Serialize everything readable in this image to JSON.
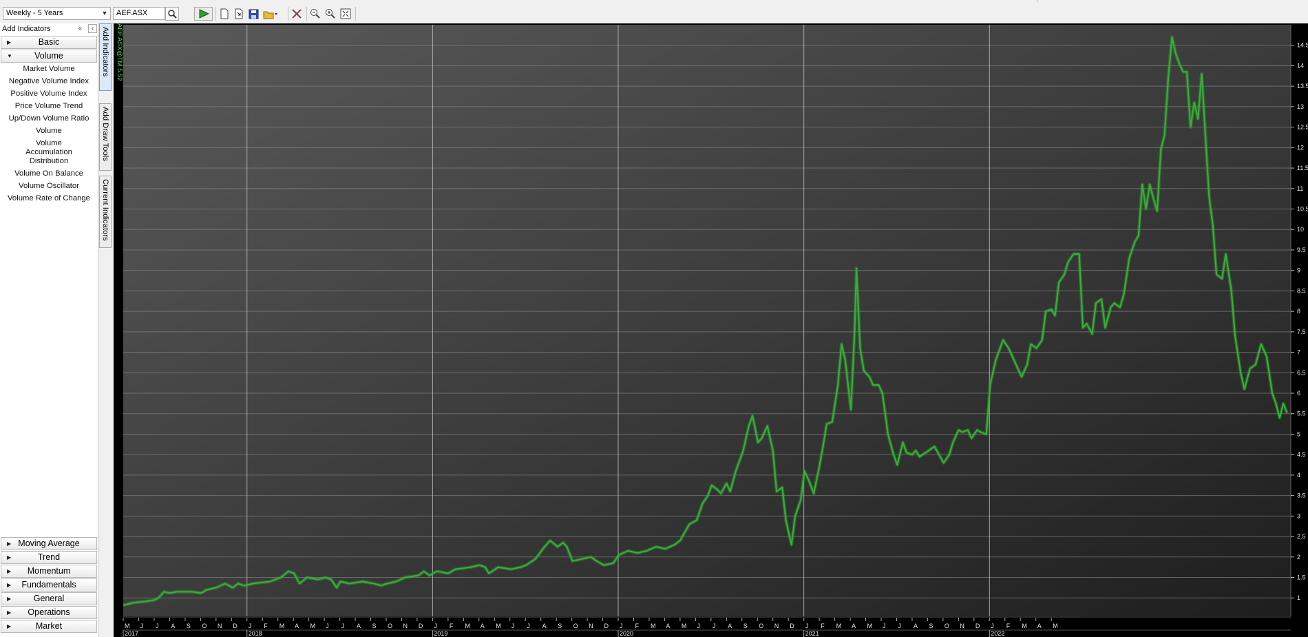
{
  "toolbar": {
    "period": "Weekly - 5 Years",
    "symbol": "AEF.ASX"
  },
  "left_panel": {
    "header": "Add Indicators",
    "categories_top": [
      "Basic",
      "Volume"
    ],
    "volume_items": [
      "Market Volume",
      "Negative Volume Index",
      "Positive Volume Index",
      "Price Volume Trend",
      "Up/Down Volume Ratio",
      "Volume",
      "Volume Accumulation Distribution",
      "Volume On Balance",
      "Volume Oscillator",
      "Volume Rate of Change"
    ],
    "categories_bottom": [
      "Moving Average",
      "Trend",
      "Momentum",
      "Fundamentals",
      "General",
      "Operations",
      "Market"
    ]
  },
  "side_tabs": [
    "Add Indicators",
    "Add Draw Tools",
    "Current Indicators"
  ],
  "chart_label": "AEF.ASX@TM 5.52",
  "colors": {
    "line": "#35b035",
    "background_top": "#5a5a5a",
    "background_bottom": "#1e1e1e",
    "grid": "#8c8c8c"
  },
  "chart_data": {
    "type": "line",
    "series_name": "",
    "x_start": "2017-05",
    "x_end": "2022-05",
    "ylim": [
      0.55,
      15.0
    ],
    "yticks": [
      "1",
      "1.5",
      "2",
      "2.5",
      "3",
      "3.5",
      "4",
      "4.5",
      "5",
      "5.5",
      "6",
      "6.5",
      "7",
      "7.5",
      "8",
      "8.5",
      "9",
      "9.5",
      "10",
      "10.5",
      "11",
      "11.5",
      "12",
      "12.5",
      "13",
      "13.5",
      "14",
      "14.5"
    ],
    "month_labels": [
      "M",
      "J",
      "J",
      "A",
      "S",
      "O",
      "N",
      "D",
      "J",
      "F",
      "M",
      "A",
      "M",
      "J",
      "J",
      "A",
      "S",
      "O",
      "N",
      "D",
      "J",
      "F",
      "M",
      "A",
      "M",
      "J",
      "J",
      "A",
      "S",
      "O",
      "N",
      "D",
      "J",
      "F",
      "M",
      "A",
      "M",
      "J",
      "J",
      "A",
      "S",
      "O",
      "N",
      "D",
      "J",
      "F",
      "M",
      "A",
      "M",
      "J",
      "J",
      "A",
      "S",
      "O",
      "N",
      "D",
      "J",
      "F",
      "M",
      "A",
      "M"
    ],
    "year_labels": [
      {
        "year": "2017",
        "month_index": 0
      },
      {
        "year": "2018",
        "month_index": 8
      },
      {
        "year": "2019",
        "month_index": 20
      },
      {
        "year": "2020",
        "month_index": 32
      },
      {
        "year": "2021",
        "month_index": 44
      },
      {
        "year": "2022",
        "month_index": 56
      }
    ],
    "points": [
      [
        2017.33,
        0.82
      ],
      [
        2017.38,
        0.88
      ],
      [
        2017.42,
        0.9
      ],
      [
        2017.46,
        0.92
      ],
      [
        2017.5,
        0.95
      ],
      [
        2017.52,
        1.0
      ],
      [
        2017.55,
        1.15
      ],
      [
        2017.58,
        1.12
      ],
      [
        2017.62,
        1.15
      ],
      [
        2017.7,
        1.15
      ],
      [
        2017.75,
        1.12
      ],
      [
        2017.78,
        1.2
      ],
      [
        2017.83,
        1.25
      ],
      [
        2017.88,
        1.35
      ],
      [
        2017.92,
        1.25
      ],
      [
        2017.95,
        1.35
      ],
      [
        2017.98,
        1.3
      ],
      [
        2018.03,
        1.35
      ],
      [
        2018.08,
        1.38
      ],
      [
        2018.12,
        1.4
      ],
      [
        2018.15,
        1.45
      ],
      [
        2018.18,
        1.5
      ],
      [
        2018.22,
        1.65
      ],
      [
        2018.25,
        1.6
      ],
      [
        2018.28,
        1.35
      ],
      [
        2018.32,
        1.5
      ],
      [
        2018.38,
        1.45
      ],
      [
        2018.42,
        1.5
      ],
      [
        2018.45,
        1.45
      ],
      [
        2018.48,
        1.25
      ],
      [
        2018.5,
        1.4
      ],
      [
        2018.55,
        1.35
      ],
      [
        2018.62,
        1.4
      ],
      [
        2018.68,
        1.35
      ],
      [
        2018.72,
        1.3
      ],
      [
        2018.75,
        1.35
      ],
      [
        2018.8,
        1.4
      ],
      [
        2018.85,
        1.5
      ],
      [
        2018.92,
        1.55
      ],
      [
        2018.95,
        1.65
      ],
      [
        2018.98,
        1.55
      ],
      [
        2019.02,
        1.65
      ],
      [
        2019.08,
        1.6
      ],
      [
        2019.12,
        1.7
      ],
      [
        2019.2,
        1.75
      ],
      [
        2019.25,
        1.8
      ],
      [
        2019.28,
        1.75
      ],
      [
        2019.3,
        1.6
      ],
      [
        2019.35,
        1.75
      ],
      [
        2019.42,
        1.7
      ],
      [
        2019.47,
        1.75
      ],
      [
        2019.5,
        1.8
      ],
      [
        2019.55,
        1.95
      ],
      [
        2019.6,
        2.25
      ],
      [
        2019.63,
        2.4
      ],
      [
        2019.67,
        2.25
      ],
      [
        2019.7,
        2.35
      ],
      [
        2019.72,
        2.25
      ],
      [
        2019.75,
        1.9
      ],
      [
        2019.8,
        1.95
      ],
      [
        2019.85,
        2.0
      ],
      [
        2019.88,
        1.9
      ],
      [
        2019.92,
        1.8
      ],
      [
        2019.97,
        1.85
      ],
      [
        2020.0,
        2.05
      ],
      [
        2020.05,
        2.15
      ],
      [
        2020.1,
        2.1
      ],
      [
        2020.15,
        2.15
      ],
      [
        2020.2,
        2.25
      ],
      [
        2020.25,
        2.2
      ],
      [
        2020.3,
        2.3
      ],
      [
        2020.33,
        2.4
      ],
      [
        2020.38,
        2.8
      ],
      [
        2020.42,
        2.9
      ],
      [
        2020.45,
        3.3
      ],
      [
        2020.48,
        3.5
      ],
      [
        2020.5,
        3.75
      ],
      [
        2020.53,
        3.65
      ],
      [
        2020.55,
        3.55
      ],
      [
        2020.58,
        3.8
      ],
      [
        2020.6,
        3.6
      ],
      [
        2020.63,
        4.1
      ],
      [
        2020.67,
        4.6
      ],
      [
        2020.7,
        5.2
      ],
      [
        2020.72,
        5.45
      ],
      [
        2020.75,
        4.8
      ],
      [
        2020.77,
        4.9
      ],
      [
        2020.8,
        5.2
      ],
      [
        2020.83,
        4.6
      ],
      [
        2020.85,
        3.6
      ],
      [
        2020.88,
        3.7
      ],
      [
        2020.9,
        2.9
      ],
      [
        2020.93,
        2.3
      ],
      [
        2020.95,
        3.0
      ],
      [
        2020.98,
        3.4
      ],
      [
        2021.0,
        4.1
      ],
      [
        2021.03,
        3.8
      ],
      [
        2021.05,
        3.55
      ],
      [
        2021.08,
        4.2
      ],
      [
        2021.1,
        4.7
      ],
      [
        2021.12,
        5.25
      ],
      [
        2021.15,
        5.3
      ],
      [
        2021.18,
        6.2
      ],
      [
        2021.2,
        7.2
      ],
      [
        2021.22,
        6.8
      ],
      [
        2021.25,
        5.6
      ],
      [
        2021.27,
        7.5
      ],
      [
        2021.28,
        9.05
      ],
      [
        2021.3,
        7.1
      ],
      [
        2021.32,
        6.55
      ],
      [
        2021.35,
        6.4
      ],
      [
        2021.37,
        6.2
      ],
      [
        2021.4,
        6.2
      ],
      [
        2021.42,
        6.0
      ],
      [
        2021.45,
        5.0
      ],
      [
        2021.48,
        4.5
      ],
      [
        2021.5,
        4.25
      ],
      [
        2021.53,
        4.8
      ],
      [
        2021.55,
        4.55
      ],
      [
        2021.58,
        4.5
      ],
      [
        2021.6,
        4.6
      ],
      [
        2021.62,
        4.45
      ],
      [
        2021.67,
        4.6
      ],
      [
        2021.7,
        4.7
      ],
      [
        2021.75,
        4.3
      ],
      [
        2021.78,
        4.5
      ],
      [
        2021.8,
        4.8
      ],
      [
        2021.83,
        5.1
      ],
      [
        2021.85,
        5.05
      ],
      [
        2021.88,
        5.1
      ],
      [
        2021.9,
        4.9
      ],
      [
        2021.93,
        5.1
      ],
      [
        2021.95,
        5.05
      ],
      [
        2021.98,
        5.0
      ],
      [
        2022.0,
        6.2
      ],
      [
        2022.03,
        6.8
      ],
      [
        2022.07,
        7.3
      ],
      [
        2022.1,
        7.1
      ],
      [
        2022.13,
        6.8
      ],
      [
        2022.17,
        6.4
      ],
      [
        2022.2,
        6.7
      ],
      [
        2022.22,
        7.2
      ],
      [
        2022.25,
        7.1
      ],
      [
        2022.28,
        7.3
      ],
      [
        2022.3,
        8.0
      ],
      [
        2022.33,
        8.05
      ],
      [
        2022.35,
        7.9
      ],
      [
        2022.37,
        8.7
      ],
      [
        2022.4,
        8.9
      ],
      [
        2022.42,
        9.2
      ],
      [
        2022.45,
        9.4
      ],
      [
        2022.48,
        9.4
      ],
      [
        2022.5,
        7.6
      ],
      [
        2022.52,
        7.7
      ],
      [
        2022.55,
        7.45
      ],
      [
        2022.57,
        8.2
      ],
      [
        2022.6,
        8.3
      ],
      [
        2022.62,
        7.6
      ],
      [
        2022.65,
        8.1
      ],
      [
        2022.67,
        8.2
      ],
      [
        2022.7,
        8.1
      ],
      [
        2022.72,
        8.4
      ],
      [
        2022.75,
        9.3
      ],
      [
        2022.78,
        9.7
      ],
      [
        2022.8,
        9.85
      ],
      [
        2022.82,
        11.1
      ],
      [
        2022.84,
        10.5
      ],
      [
        2022.86,
        11.1
      ],
      [
        2022.88,
        10.75
      ],
      [
        2022.9,
        10.45
      ],
      [
        2022.92,
        11.95
      ],
      [
        2022.94,
        12.3
      ],
      [
        2022.96,
        13.7
      ],
      [
        2022.98,
        14.7
      ],
      [
        2023.0,
        14.3
      ],
      [
        2023.02,
        14.05
      ],
      [
        2023.04,
        13.85
      ],
      [
        2023.06,
        13.85
      ],
      [
        2023.08,
        12.5
      ],
      [
        2023.1,
        13.1
      ],
      [
        2023.12,
        12.7
      ],
      [
        2023.14,
        13.8
      ],
      [
        2023.16,
        12.3
      ],
      [
        2023.18,
        10.8
      ],
      [
        2023.2,
        10.1
      ],
      [
        2023.22,
        8.9
      ],
      [
        2023.25,
        8.8
      ],
      [
        2023.27,
        9.4
      ],
      [
        2023.3,
        8.5
      ],
      [
        2023.32,
        7.4
      ],
      [
        2023.35,
        6.5
      ],
      [
        2023.37,
        6.1
      ],
      [
        2023.4,
        6.6
      ],
      [
        2023.43,
        6.7
      ],
      [
        2023.46,
        7.2
      ],
      [
        2023.49,
        6.9
      ],
      [
        2023.52,
        6.0
      ],
      [
        2023.54,
        5.75
      ],
      [
        2023.56,
        5.4
      ],
      [
        2023.58,
        5.75
      ],
      [
        2023.6,
        5.52
      ]
    ]
  }
}
